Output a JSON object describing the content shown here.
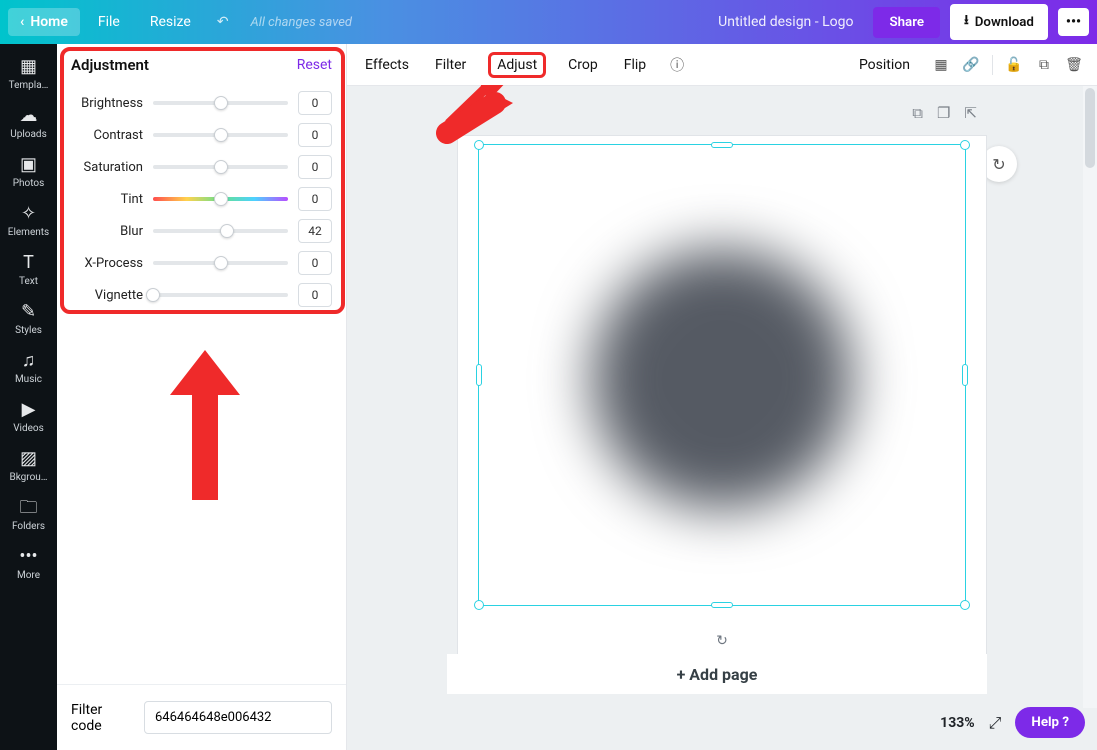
{
  "topbar": {
    "home": "Home",
    "file": "File",
    "resize": "Resize",
    "saved_status": "All changes saved",
    "doc_title": "Untitled design - Logo",
    "share": "Share",
    "download": "Download",
    "more": "•••"
  },
  "rail": [
    {
      "id": "templates",
      "label": "Templa…",
      "icon": "▦"
    },
    {
      "id": "uploads",
      "label": "Uploads",
      "icon": "☁"
    },
    {
      "id": "photos",
      "label": "Photos",
      "icon": "▣"
    },
    {
      "id": "elements",
      "label": "Elements",
      "icon": "✧"
    },
    {
      "id": "text",
      "label": "Text",
      "icon": "T"
    },
    {
      "id": "styles",
      "label": "Styles",
      "icon": "✎"
    },
    {
      "id": "music",
      "label": "Music",
      "icon": "♫"
    },
    {
      "id": "videos",
      "label": "Videos",
      "icon": "▶"
    },
    {
      "id": "bkground",
      "label": "Bkgrou…",
      "icon": "▨"
    },
    {
      "id": "folders",
      "label": "Folders",
      "icon": "🗀"
    },
    {
      "id": "more",
      "label": "More",
      "icon": "•••"
    }
  ],
  "context": {
    "items": [
      "Effects",
      "Filter",
      "Adjust",
      "Crop",
      "Flip"
    ],
    "active": "Adjust",
    "position": "Position"
  },
  "panel": {
    "title": "Adjustment",
    "reset": "Reset",
    "sliders": [
      {
        "label": "Brightness",
        "value": 0,
        "pos": 50
      },
      {
        "label": "Contrast",
        "value": 0,
        "pos": 50
      },
      {
        "label": "Saturation",
        "value": 0,
        "pos": 50
      },
      {
        "label": "Tint",
        "value": 0,
        "pos": 50,
        "tint": true
      },
      {
        "label": "Blur",
        "value": 42,
        "pos": 55,
        "fillFrom": 50,
        "fillTo": 55
      },
      {
        "label": "X-Process",
        "value": 0,
        "pos": 50
      },
      {
        "label": "Vignette",
        "value": 0,
        "pos": 0
      }
    ],
    "filter_code_label": "Filter code",
    "filter_code_value": "646464648e006432"
  },
  "workspace": {
    "add_page": "+ Add page",
    "zoom": "133%",
    "help": "Help ?"
  }
}
